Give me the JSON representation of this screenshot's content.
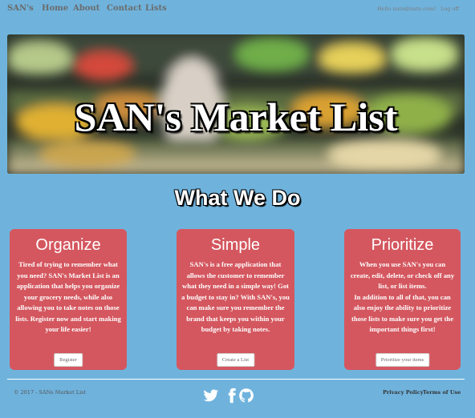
{
  "nav": {
    "brand": "SAN's",
    "links": [
      "Home",
      "About",
      "Contact",
      "Lists"
    ],
    "user_greeting": "Hello nate@nate.com!",
    "logout": "Log off"
  },
  "hero": {
    "title": "SAN's Market List"
  },
  "section": {
    "title": "What We Do"
  },
  "cards": [
    {
      "title": "Organize",
      "text": "Tired of trying to remember what you need? SAN's Market List is an application that helps you organize your grocery needs, while also allowing you to take notes on those lists. Register now and start making your life easier!",
      "button": "Register"
    },
    {
      "title": "Simple",
      "text": "SAN's is a free application that allows the customer to remember what they need in a simple way! Got a budget to stay in? With SAN's, you can make sure you remember the brand that keeps you within your budget by taking notes.",
      "button": "Create a List"
    },
    {
      "title": "Prioritize",
      "text": "When you use SAN's you can create, edit, delete, or check off any list, or list items.\nIn addition to all of that, you can also enjoy the ability to prioritize those lists to make sure you get the important things first!",
      "button": "Prioritize your items"
    }
  ],
  "footer": {
    "copyright": "© 2017 - SANs Market List",
    "social_icons": [
      "twitter-icon",
      "facebook-icon",
      "github-icon"
    ],
    "privacy": "Privacy Policy",
    "terms": "Terms of Use"
  },
  "colors": {
    "background": "#6fb3dd",
    "card": "#d4575f"
  }
}
